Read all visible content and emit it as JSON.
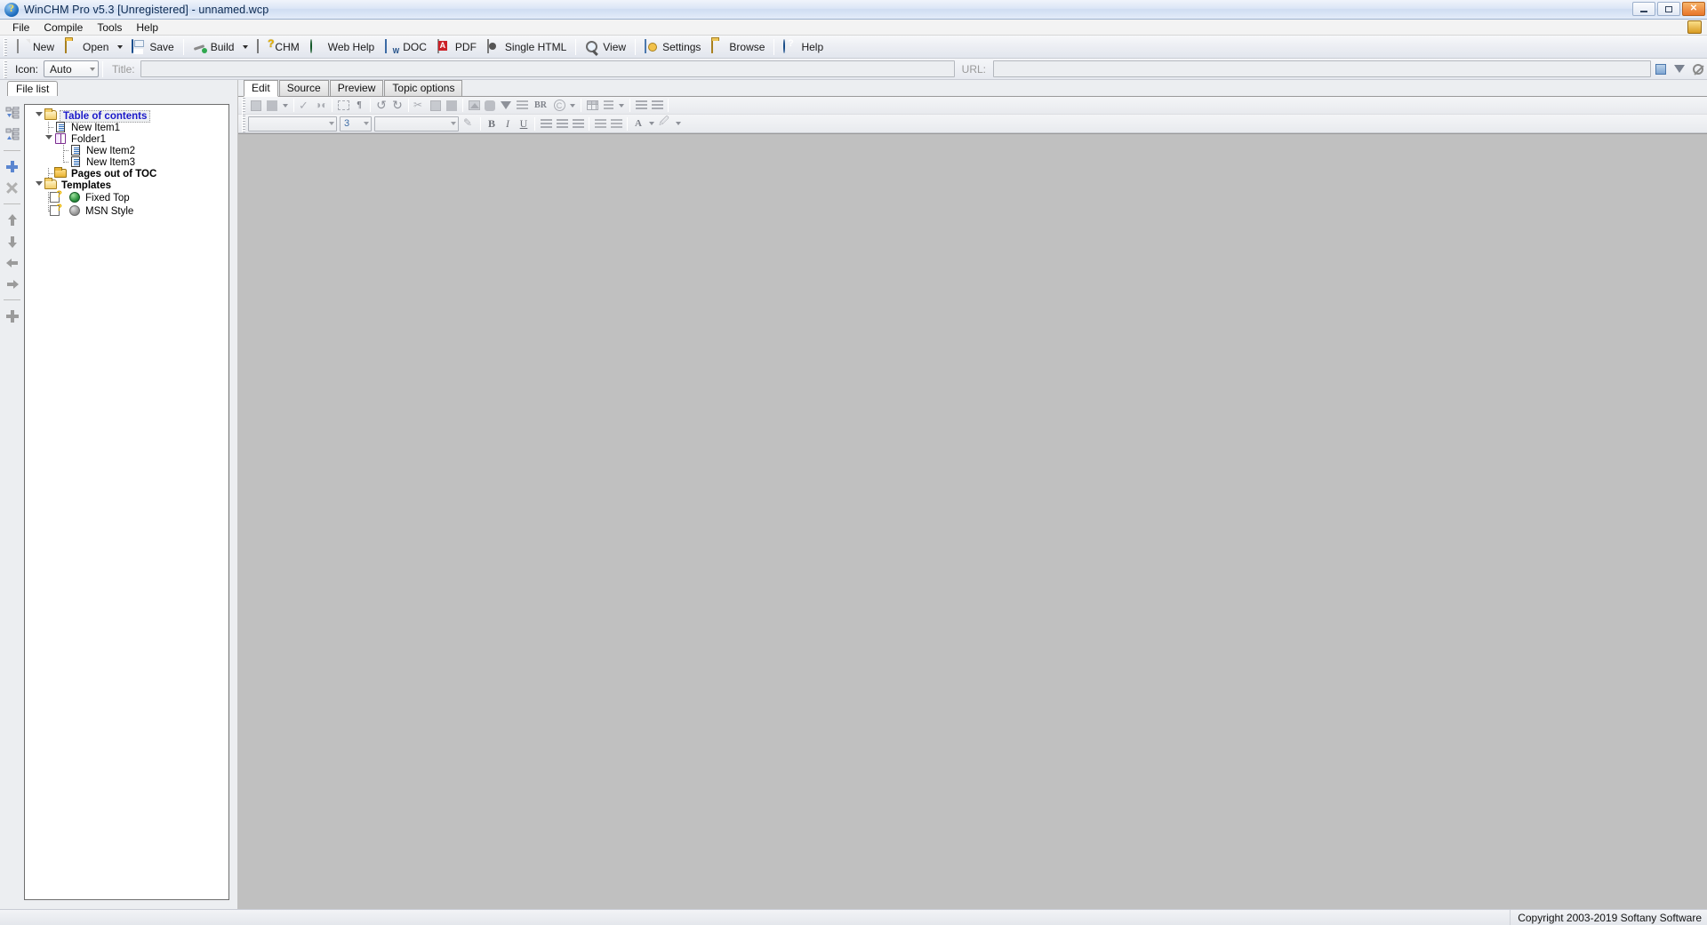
{
  "window": {
    "title": "WinCHM Pro v5.3 [Unregistered] - unnamed.wcp",
    "app_icon": "question-globe-icon",
    "buttons": {
      "minimize": "minimize-button",
      "maximize": "maximize-button",
      "close": "close-button"
    }
  },
  "menubar": {
    "items": [
      {
        "label": "File"
      },
      {
        "label": "Compile"
      },
      {
        "label": "Tools"
      },
      {
        "label": "Help"
      }
    ]
  },
  "toolbar": {
    "items": [
      {
        "label": "New",
        "icon": "new-document-icon"
      },
      {
        "label": "Open",
        "icon": "open-folder-icon",
        "has_dropdown": true
      },
      {
        "label": "Save",
        "icon": "floppy-disk-icon"
      },
      {
        "label": "Build",
        "icon": "build-hammer-icon",
        "has_dropdown": true
      },
      {
        "label": "CHM",
        "icon": "chm-help-file-icon"
      },
      {
        "label": "Web Help",
        "icon": "green-globe-icon"
      },
      {
        "label": "DOC",
        "icon": "word-document-icon"
      },
      {
        "label": "PDF",
        "icon": "pdf-file-icon"
      },
      {
        "label": "Single HTML",
        "icon": "single-html-icon"
      },
      {
        "label": "View",
        "icon": "magnifier-icon"
      },
      {
        "label": "Settings",
        "icon": "settings-icon"
      },
      {
        "label": "Browse",
        "icon": "browse-folder-icon"
      },
      {
        "label": "Help",
        "icon": "help-question-icon"
      }
    ]
  },
  "property_row": {
    "icon_label": "Icon:",
    "icon_value": "Auto",
    "title_label": "Title:",
    "title_value": "",
    "title_placeholder": "",
    "url_label": "URL:",
    "url_value": "",
    "buttons": [
      {
        "name": "insert-picture-button",
        "icon": "picture-icon"
      },
      {
        "name": "bookmark-button",
        "icon": "flag-icon"
      },
      {
        "name": "clear-button",
        "icon": "no-entry-icon"
      }
    ]
  },
  "left_pane": {
    "tab_label": "File list",
    "vtoolbar": [
      {
        "name": "expand-all-button",
        "icon": "expand-tree-icon"
      },
      {
        "name": "collapse-all-button",
        "icon": "collapse-tree-icon"
      },
      {
        "name": "add-item-button",
        "icon": "plus-icon"
      },
      {
        "name": "delete-item-button",
        "icon": "x-cross-icon"
      },
      {
        "name": "move-up-button",
        "icon": "arrow-up-icon"
      },
      {
        "name": "move-down-button",
        "icon": "arrow-down-icon"
      },
      {
        "name": "move-left-button",
        "icon": "arrow-left-icon"
      },
      {
        "name": "move-right-button",
        "icon": "arrow-right-icon"
      },
      {
        "name": "move-all-button",
        "icon": "move-cross-icon"
      }
    ],
    "tree": [
      {
        "label": "Table of contents",
        "icon": "open-folder-icon",
        "depth": 0,
        "expanded": true,
        "style": "selected-link",
        "connector": "root"
      },
      {
        "label": "New Item1",
        "icon": "page-icon",
        "depth": 1,
        "expanded": null,
        "style": "normal",
        "connector": "tee"
      },
      {
        "label": "Folder1",
        "icon": "book-icon",
        "depth": 1,
        "expanded": true,
        "style": "normal",
        "connector": "tee"
      },
      {
        "label": "New Item2",
        "icon": "page-icon",
        "depth": 2,
        "expanded": null,
        "style": "normal",
        "connector": "tee"
      },
      {
        "label": "New Item3",
        "icon": "page-icon",
        "depth": 2,
        "expanded": null,
        "style": "normal",
        "connector": "ell"
      },
      {
        "label": "Pages out of  TOC",
        "icon": "closed-folder-icon",
        "depth": 1,
        "expanded": null,
        "style": "bold",
        "connector": "tee"
      },
      {
        "label": "Templates",
        "icon": "open-folder-icon",
        "depth": 0,
        "expanded": true,
        "style": "bold",
        "connector": "root"
      },
      {
        "label": "Fixed Top",
        "icon": "template-green-globe-icon",
        "depth": 1,
        "expanded": null,
        "style": "normal",
        "connector": "tee"
      },
      {
        "label": "MSN Style",
        "icon": "template-gray-globe-icon",
        "depth": 1,
        "expanded": null,
        "style": "normal",
        "connector": "ell"
      }
    ]
  },
  "editor": {
    "tabs": [
      {
        "label": "Edit",
        "active": true
      },
      {
        "label": "Source",
        "active": false
      },
      {
        "label": "Preview",
        "active": false
      },
      {
        "label": "Topic options",
        "active": false
      }
    ],
    "toolbar_row1": [
      {
        "name": "save-topic-button",
        "icon": "save-icon"
      },
      {
        "name": "save-as-button",
        "icon": "save-as-icon",
        "has_dropdown": true
      },
      {
        "name": "spell-check-button",
        "icon": "spell-check-icon"
      },
      {
        "name": "find-replace-button",
        "icon": "binoculars-icon"
      },
      {
        "name": "show-borders-button",
        "icon": "dashed-box-icon"
      },
      {
        "name": "show-paragraph-button",
        "icon": "pilcrow-icon"
      },
      {
        "name": "undo-button",
        "icon": "undo-arrow-icon"
      },
      {
        "name": "redo-button",
        "icon": "redo-arrow-icon"
      },
      {
        "name": "cut-button",
        "icon": "scissors-icon"
      },
      {
        "name": "copy-button",
        "icon": "copy-icon"
      },
      {
        "name": "paste-button",
        "icon": "paste-icon"
      },
      {
        "name": "insert-image-button",
        "icon": "image-icon"
      },
      {
        "name": "insert-object-button",
        "icon": "object-icon"
      },
      {
        "name": "filter-button",
        "icon": "funnel-icon"
      },
      {
        "name": "insert-list-button",
        "icon": "sorted-list-icon"
      },
      {
        "name": "insert-break-button",
        "icon": "br-text-icon",
        "text": "BR"
      },
      {
        "name": "insert-symbol-button",
        "icon": "copyright-icon",
        "has_dropdown": true
      },
      {
        "name": "insert-table-button",
        "icon": "table-icon"
      },
      {
        "name": "insert-field-button",
        "icon": "insert-field-icon",
        "has_dropdown": true
      },
      {
        "name": "decrease-indent-button",
        "icon": "outdent-icon"
      },
      {
        "name": "increase-indent-button",
        "icon": "indent-icon"
      }
    ],
    "toolbar_row2": {
      "font_name": "",
      "font_size": "3",
      "font_style": "",
      "clear_format": {
        "name": "clear-formatting-button",
        "icon": "eraser-icon"
      },
      "bold": "B",
      "italic": "I",
      "underline": "U",
      "buttons": [
        {
          "name": "align-left-button",
          "icon": "align-left-icon"
        },
        {
          "name": "align-center-button",
          "icon": "align-center-icon"
        },
        {
          "name": "align-right-button",
          "icon": "align-right-icon"
        },
        {
          "name": "numbered-list-button",
          "icon": "numbered-list-icon"
        },
        {
          "name": "bulleted-list-button",
          "icon": "bulleted-list-icon"
        },
        {
          "name": "font-color-button",
          "icon": "font-color-icon",
          "has_dropdown": true
        },
        {
          "name": "highlight-color-button",
          "icon": "highlighter-icon",
          "has_dropdown": true
        }
      ]
    },
    "canvas_color": "#c0c0c0"
  },
  "statusbar": {
    "copyright": "Copyright 2003-2019 Softany Software"
  }
}
